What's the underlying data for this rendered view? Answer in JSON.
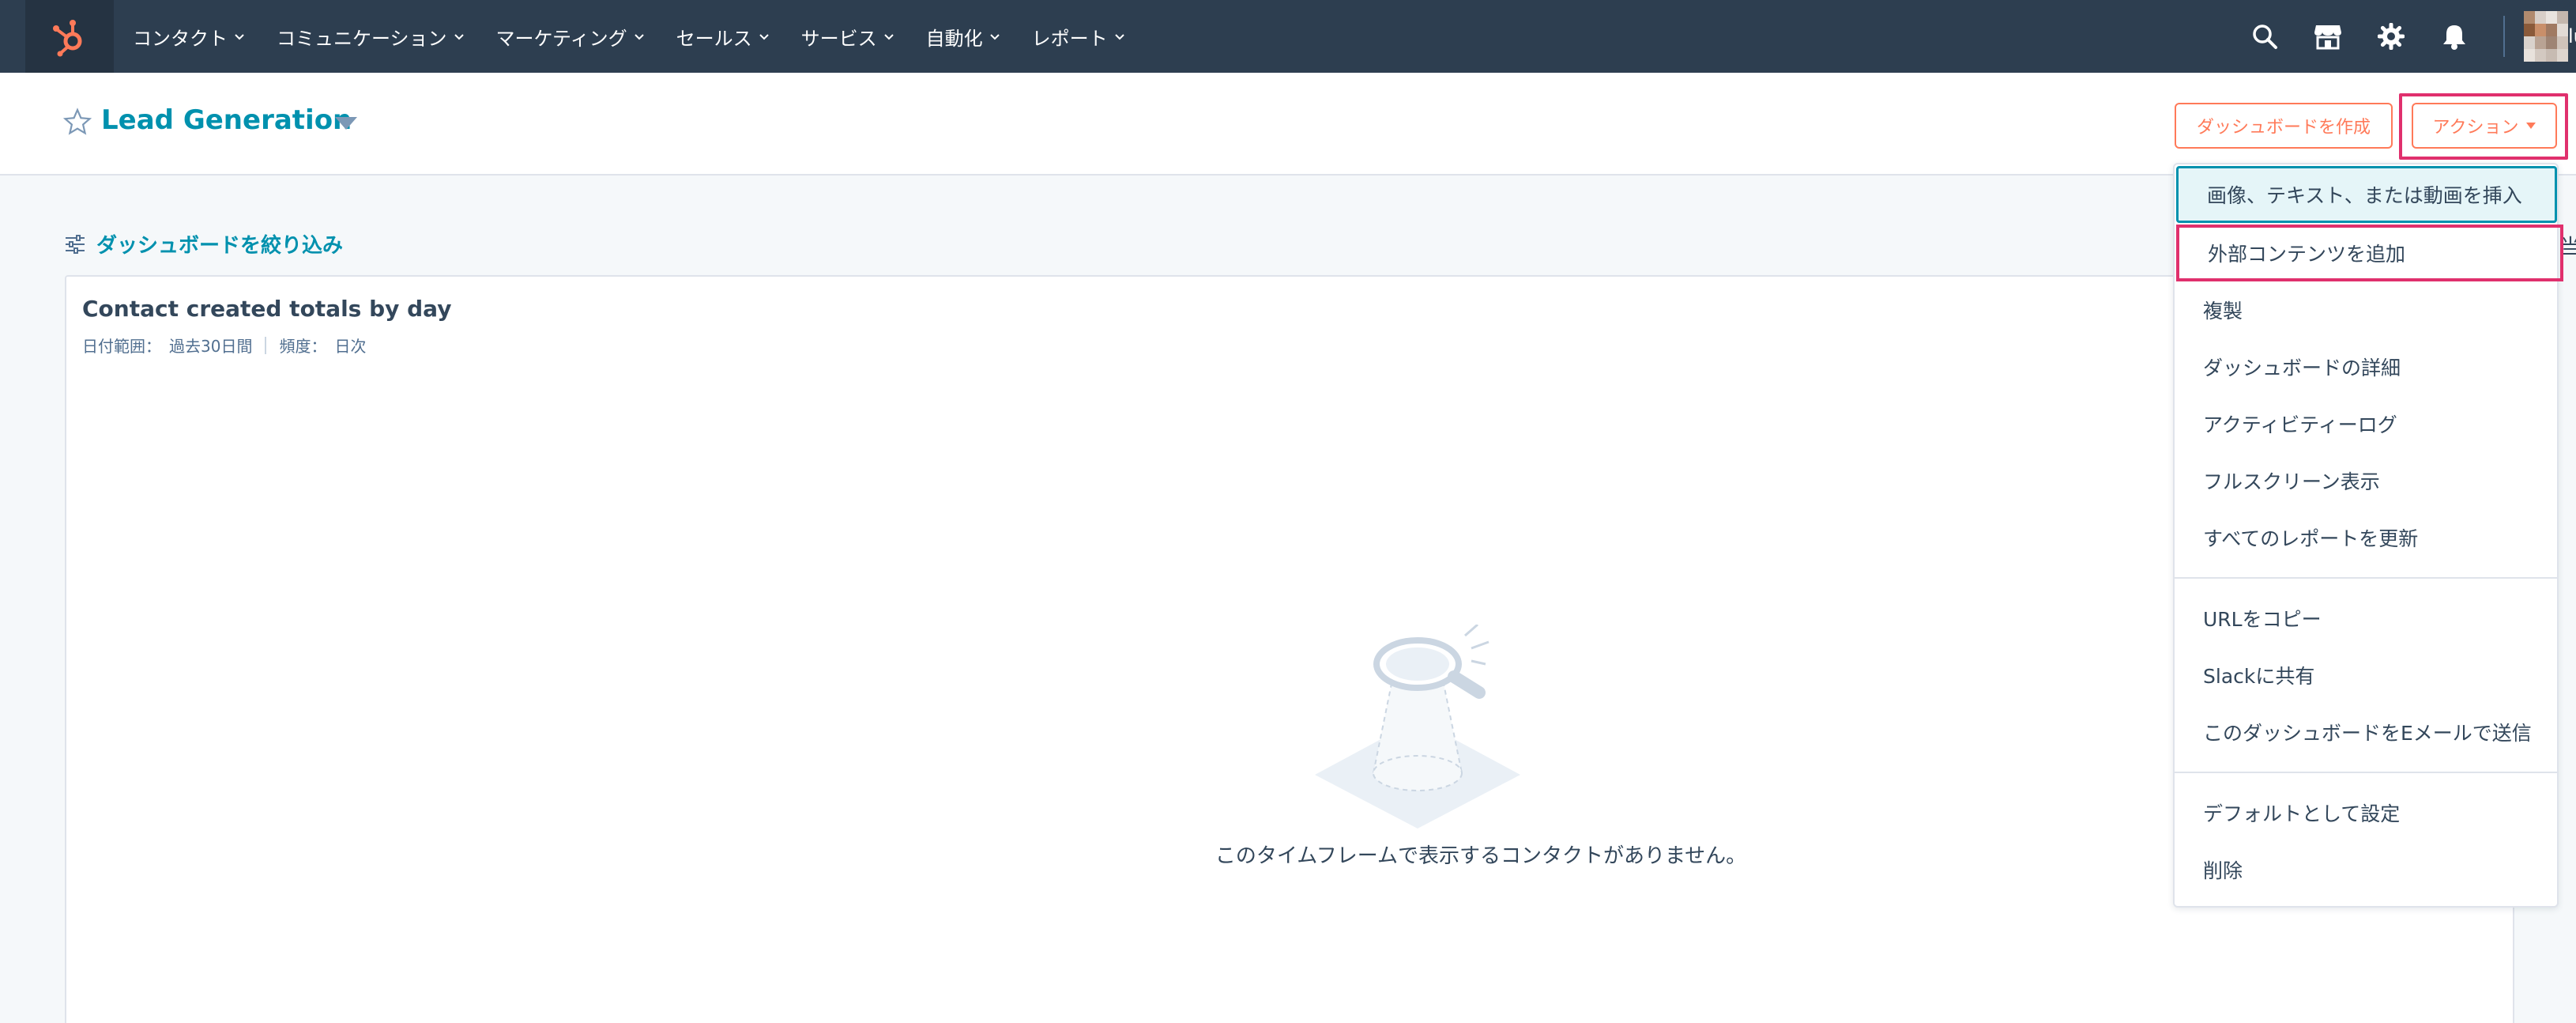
{
  "nav": {
    "items": [
      {
        "label": "コンタクト"
      },
      {
        "label": "コミュニケーション"
      },
      {
        "label": "マーケティング"
      },
      {
        "label": "セールス"
      },
      {
        "label": "サービス"
      },
      {
        "label": "自動化"
      },
      {
        "label": "レポート"
      }
    ],
    "icons": [
      "search-icon",
      "marketplace-icon",
      "settings-icon",
      "notifications-icon"
    ],
    "account_tail": "lu"
  },
  "header": {
    "title": "Lead Generation",
    "create_label": "ダッシュボードを作成",
    "actions_label": "アクション"
  },
  "filter": {
    "label": "ダッシュボードを絞り込み",
    "right_clip": "当"
  },
  "report": {
    "title": "Contact created totals by day",
    "date_range_label": "日付範囲：",
    "date_range_value": "過去30日間",
    "frequency_label": "頻度：",
    "frequency_value": "日次",
    "empty_message": "このタイムフレームで表示するコンタクトがありません。"
  },
  "menu": {
    "items": [
      {
        "label": "画像、テキスト、または動画を挿入"
      },
      {
        "label": "外部コンテンツを追加"
      },
      {
        "label": "複製"
      },
      {
        "label": "ダッシュボードの詳細"
      },
      {
        "label": "アクティビティーログ"
      },
      {
        "label": "フルスクリーン表示"
      },
      {
        "label": "すべてのレポートを更新"
      },
      {
        "label": "URLをコピー"
      },
      {
        "label": "Slackに共有"
      },
      {
        "label": "このダッシュボードをEメールで送信"
      },
      {
        "label": "デフォルトとして設定"
      },
      {
        "label": "削除"
      }
    ]
  },
  "colors": {
    "nav_bg": "#2d3e50",
    "brand_orange": "#ff7a59",
    "link_teal": "#0091ae",
    "highlight_pink": "#e0306d"
  }
}
